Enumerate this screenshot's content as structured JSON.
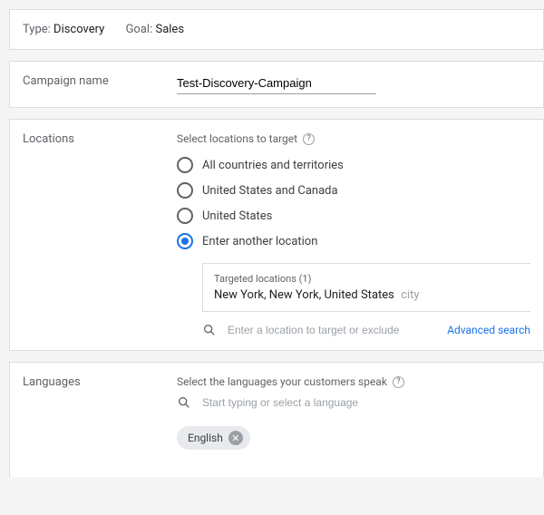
{
  "header": {
    "type_key": "Type:",
    "type_value": "Discovery",
    "goal_key": "Goal:",
    "goal_value": "Sales"
  },
  "campaign": {
    "label": "Campaign name",
    "value": "Test-Discovery-Campaign"
  },
  "locations": {
    "label": "Locations",
    "heading": "Select locations to target",
    "options": [
      {
        "label": "All countries and territories"
      },
      {
        "label": "United States and Canada"
      },
      {
        "label": "United States"
      },
      {
        "label": "Enter another location"
      }
    ],
    "selected_index": 3,
    "targeted": {
      "heading": "Targeted locations (1)",
      "name": "New York, New York, United States",
      "kind": "city"
    },
    "search_placeholder": "Enter a location to target or exclude",
    "advanced_link": "Advanced search"
  },
  "languages": {
    "label": "Languages",
    "heading": "Select the languages your customers speak",
    "search_placeholder": "Start typing or select a language",
    "chips": [
      "English"
    ]
  }
}
